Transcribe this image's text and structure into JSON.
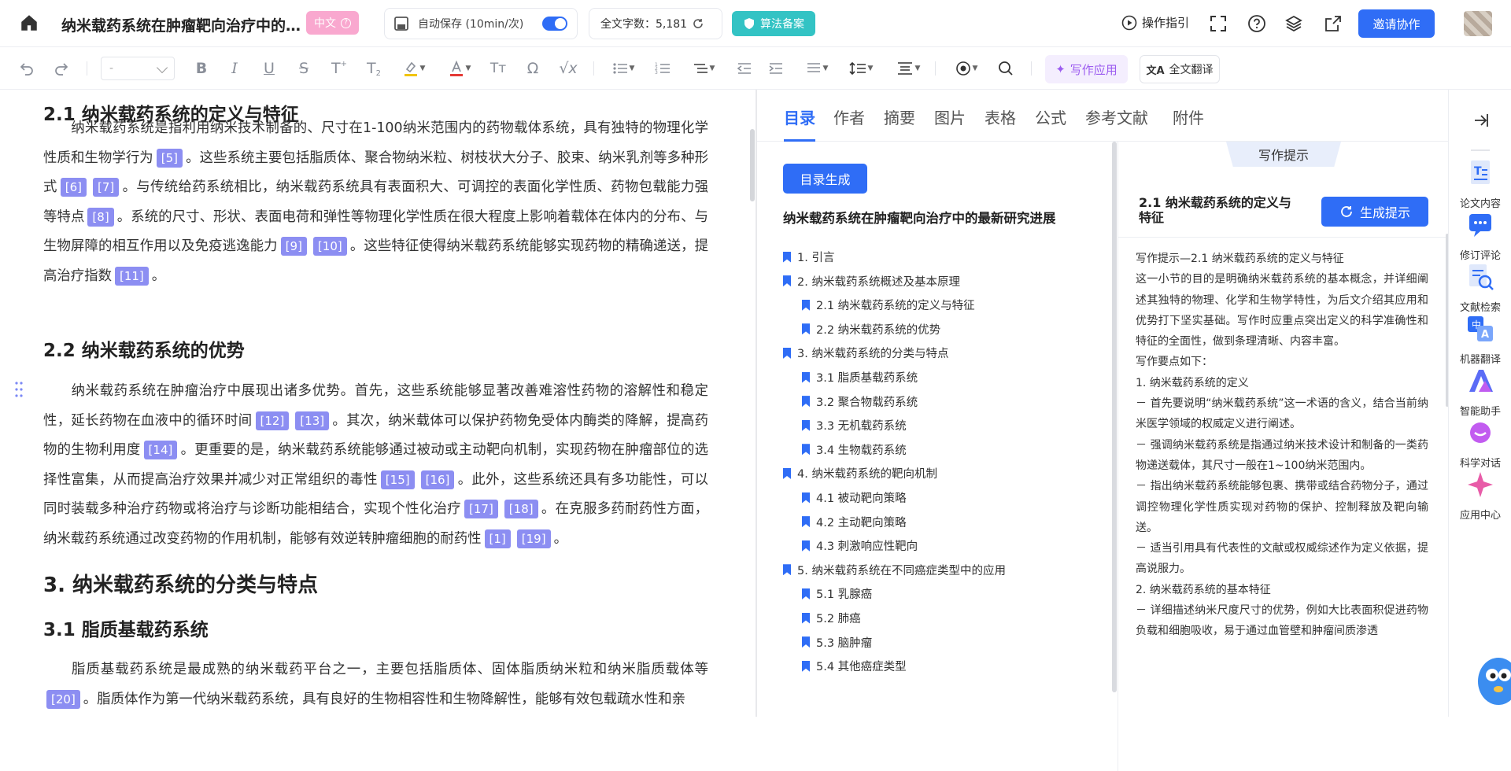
{
  "header": {
    "doc_title": "纳米载药系统在肿瘤靶向治疗中的…",
    "lang_label": "中文",
    "autosave_label": "自动保存 (10min/次)",
    "wordcount_label": "全文字数：5,181",
    "algo_label": "算法备案",
    "guide_label": "操作指引",
    "invite_label": "邀请协作"
  },
  "toolbar": {
    "font_select_value": "-",
    "write_app_label": "写作应用",
    "full_translate_label": "全文翻译",
    "icons": [
      "undo-icon",
      "redo-icon",
      "bold-icon",
      "italic-icon",
      "underline-icon",
      "strikethrough-icon",
      "superscript-icon",
      "subscript-icon",
      "highlight-icon",
      "font-color-icon",
      "clear-format-icon",
      "special-char-icon",
      "formula-icon",
      "bullet-list-icon",
      "numbered-list-icon",
      "multilevel-list-icon",
      "outdent-icon",
      "indent-icon",
      "align-icon",
      "line-spacing-icon",
      "paragraph-spacing-icon",
      "style-icon",
      "search-icon"
    ]
  },
  "editor": {
    "h_2_1": "2.1 纳米载药系统的定义与特征",
    "p1": [
      "纳米载药系统是指利用纳米技术制备的、尺寸在1-100纳米范围内的药物载体系统，具有独特的物理化学性质和生物学行为",
      "[5]",
      "。这些系统主要包括脂质体、聚合物纳米粒、树枝状大分子、胶束、纳米乳剂等多种形式",
      "[6]",
      "[7]",
      "。与传统给药系统相比，纳米载药系统具有表面积大、可调控的表面化学性质、药物包载能力强等特点",
      "[8]",
      "。系统的尺寸、形状、表面电荷和弹性等物理化学性质在很大程度上影响着载体在体内的分布、与生物屏障的相互作用以及免疫逃逸能力",
      "[9]",
      "[10]",
      "。这些特征使得纳米载药系统能够实现药物的精确递送，提高治疗指数",
      "[11]",
      "。"
    ],
    "h_2_2": "2.2 纳米载药系统的优势",
    "p2": [
      "纳米载药系统在肿瘤治疗中展现出诸多优势。首先，这些系统能够显著改善难溶性药物的溶解性和稳定性，延长药物在血液中的循环时间",
      "[12]",
      "[13]",
      "。其次，纳米载体可以保护药物免受体内酶类的降解，提高药物的生物利用度",
      "[14]",
      "。更重要的是，纳米载药系统能够通过被动或主动靶向机制，实现药物在肿瘤部位的选择性富集，从而提高治疗效果并减少对正常组织的毒性",
      "[15]",
      "[16]",
      "。此外，这些系统还具有多功能性，可以同时装载多种治疗药物或将治疗与诊断功能相结合，实现个性化治疗",
      "[17]",
      "[18]",
      "。在克服多药耐药性方面，纳米载药系统通过改变药物的作用机制，能够有效逆转肿瘤细胞的耐药性",
      "[1]",
      "[19]",
      "。"
    ],
    "h_3": "3. 纳米载药系统的分类与特点",
    "h_3_1": "3.1 脂质基载药系统",
    "p3": [
      "脂质基载药系统是最成熟的纳米载药平台之一，主要包括脂质体、固体脂质纳米粒和纳米脂质载体等",
      "[20]",
      "。脂质体作为第一代纳米载药系统，具有良好的生物相容性和生物降解性，能够有效包载疏水性和亲"
    ]
  },
  "panel": {
    "tabs": [
      "目录",
      "作者",
      "摘要",
      "图片",
      "表格",
      "公式",
      "参考文献",
      "附件"
    ],
    "gen_toc_label": "目录生成",
    "toc_title": "纳米载药系统在肿瘤靶向治疗中的最新研究进展",
    "toc": [
      {
        "label": "1. 引言",
        "level": 1
      },
      {
        "label": "2. 纳米载药系统概述及基本原理",
        "level": 1
      },
      {
        "label": "2.1 纳米载药系统的定义与特征",
        "level": 2
      },
      {
        "label": "2.2 纳米载药系统的优势",
        "level": 2
      },
      {
        "label": "3. 纳米载药系统的分类与特点",
        "level": 1
      },
      {
        "label": "3.1 脂质基载药系统",
        "level": 2
      },
      {
        "label": "3.2 聚合物载药系统",
        "level": 2
      },
      {
        "label": "3.3 无机载药系统",
        "level": 2
      },
      {
        "label": "3.4 生物载药系统",
        "level": 2
      },
      {
        "label": "4. 纳米载药系统的靶向机制",
        "level": 1
      },
      {
        "label": "4.1 被动靶向策略",
        "level": 2
      },
      {
        "label": "4.2 主动靶向策略",
        "level": 2
      },
      {
        "label": "4.3 刺激响应性靶向",
        "level": 2
      },
      {
        "label": "5. 纳米载药系统在不同癌症类型中的应用",
        "level": 1
      },
      {
        "label": "5.1 乳腺癌",
        "level": 2
      },
      {
        "label": "5.2 肺癌",
        "level": 2
      },
      {
        "label": "5.3 脑肿瘤",
        "level": 2
      },
      {
        "label": "5.4 其他癌症类型",
        "level": 2
      }
    ],
    "hint_tag": "写作提示",
    "hint_section": "2.1 纳米载药系统的定义与特征",
    "gen_hint_label": "生成提示",
    "hint_lines": [
      "写作提示—2.1 纳米载药系统的定义与特征",
      "这一小节的目的是明确纳米载药系统的基本概念，并详细阐述其独特的物理、化学和生物学特性，为后文介绍其应用和优势打下坚实基础。写作时应重点突出定义的科学准确性和特征的全面性，做到条理清晰、内容丰富。",
      "写作要点如下：",
      "1.  纳米载药系统的定义",
      "－ 首先要说明“纳米载药系统”这一术语的含义，结合当前纳米医学领域的权威定义进行阐述。",
      "－ 强调纳米载药系统是指通过纳米技术设计和制备的一类药物递送载体，其尺寸一般在1~100纳米范围内。",
      "－ 指出纳米载药系统能够包裹、携带或结合药物分子，通过调控物理化学性质实现对药物的保护、控制释放及靶向输送。",
      "－ 适当引用具有代表性的文献或权威综述作为定义依据，提高说服力。",
      "2.  纳米载药系统的基本特征",
      "－ 详细描述纳米尺度尺寸的优势，例如大比表面积促进药物负载和细胞吸收，易于通过血管壁和肿瘤间质渗透"
    ]
  },
  "rail": {
    "items": [
      "论文内容",
      "修订评论",
      "文献检索",
      "机器翻译",
      "智能助手",
      "科学对话",
      "应用中心"
    ]
  },
  "colors": {
    "accent": "#2f6df6",
    "cite": "#8c8ef2",
    "lang_pill": "#f9a8cf",
    "algo": "#33c3c4"
  }
}
